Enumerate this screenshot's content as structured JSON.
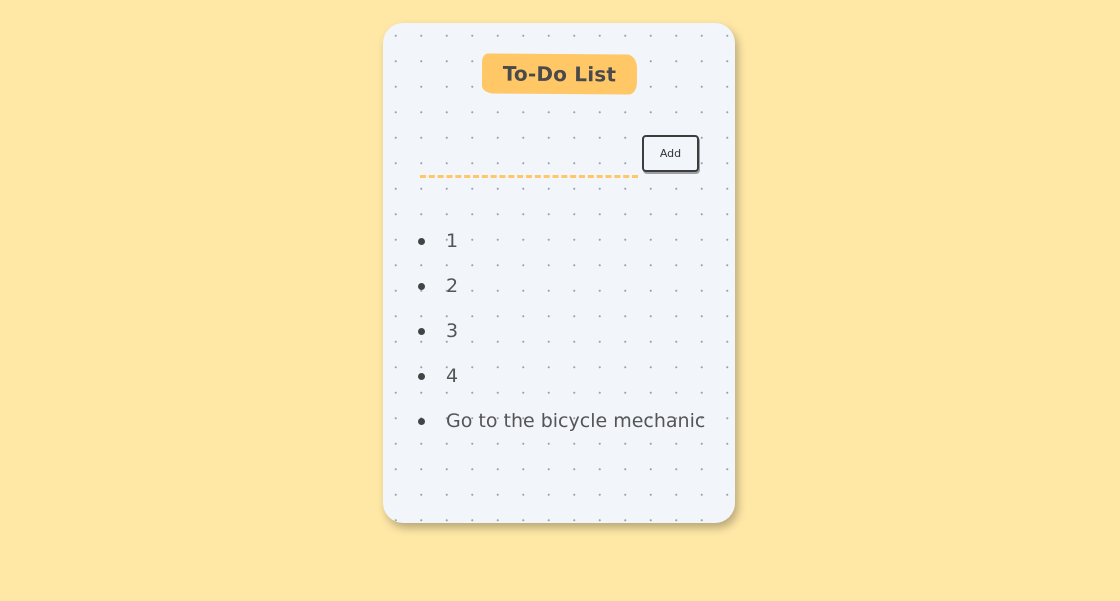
{
  "app": {
    "title": "To-Do List"
  },
  "form": {
    "input_value": "",
    "input_placeholder": "",
    "add_label": "Add"
  },
  "tasks": [
    {
      "text": "1"
    },
    {
      "text": "2"
    },
    {
      "text": "3"
    },
    {
      "text": "4"
    },
    {
      "text": "Go to the bicycle mechanic"
    }
  ],
  "colors": {
    "page_background": "#ffe8a6",
    "card_background": "#f2f5fa",
    "accent": "#ffc766",
    "text": "#444444"
  }
}
